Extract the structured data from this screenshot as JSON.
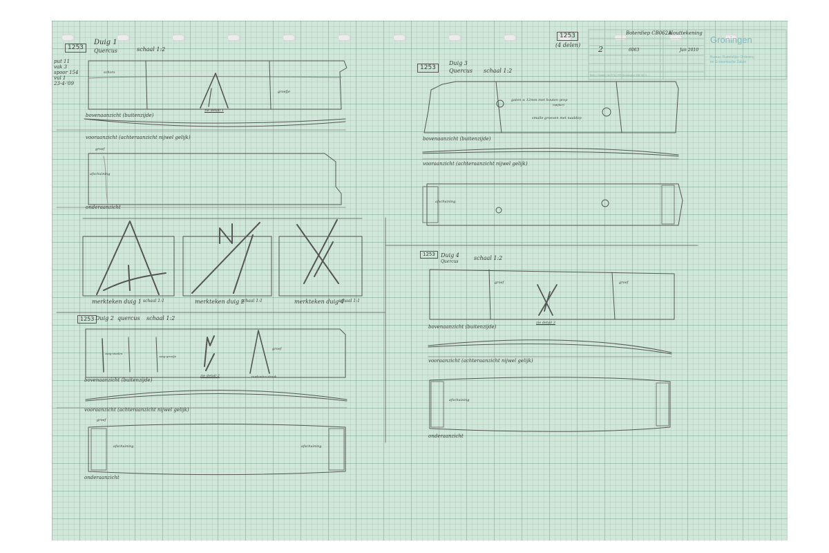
{
  "sheet": {
    "ref_number": "1253",
    "ref_count": "(4 delen)",
    "title_block": {
      "project": "Boterdiep CB062A",
      "subject": "Houttekening",
      "sheet_no": "2",
      "code": "6063",
      "date": "Jan 2010",
      "logo": "Groningen",
      "org_line1": "Bureau Ruimtelijke Ordening",
      "org_line2": "en Economische Zaken",
      "footer": "Brfo | Ondiep 4n 9711 FR   Groningen 050 3671 ..."
    }
  },
  "field_notes": [
    "put 11",
    "vak 3",
    "spoor 154",
    "vul 1",
    "23-4-'09"
  ],
  "duig1": {
    "box": "1253",
    "title": "Duig 1",
    "species": "Quercus",
    "scale": "schaal 1:2",
    "top_caption": "bovenaanzicht (buitenzijde)",
    "front_caption": "vooraanzicht (achteraanzicht nijwel gelijk)",
    "bottom_caption": "onderaanzicht",
    "labels": {
      "schors": "schors",
      "groefje": "groefje",
      "zie_detail": "zie detail 1",
      "groef": "groef",
      "afschuining": "afschuining"
    }
  },
  "marks": {
    "m1": "merkteken duig 1",
    "m1_scale": "schaal 1:1",
    "m2": "merkteken duig 2",
    "m2_scale": "schaal 1:1",
    "m3": "merkteken duig 4",
    "m3_scale": "schaal 1:1"
  },
  "duig2": {
    "box": "1253",
    "title": "Duig 2",
    "species": "quercus",
    "scale": "schaal 1:2",
    "top_caption": "bovenaanzicht (buitenzijde)",
    "front_caption": "vooraanzicht (achteraanzicht nijwel gelijk)",
    "bottom_caption": "onderaanzicht",
    "labels": {
      "zaagsnede": "zaag-sneden",
      "groefje": "zaag-groefje",
      "zie_detail": "zie detail 2",
      "groef": "groef",
      "ruw": "ruwhouten strook",
      "afschuining": "afschuining",
      "groef2": "groef"
    }
  },
  "duig3": {
    "box": "1253",
    "title": "Duig 3",
    "species": "Quercus",
    "scale": "schaal 1:2",
    "note1": "gaten ± 12mm met houten prop",
    "note1b": "(spijker)",
    "note2": "smalle groeven met naaldop",
    "top_caption": "bovenaanzicht (buitenzijde)",
    "front_caption": "vooraanzicht (achteraanzicht nijwel gelijk)",
    "afschuining": "afschuining"
  },
  "duig4": {
    "box": "1253",
    "title": "Duig 4",
    "species": "Quercus",
    "scale": "schaal 1:2",
    "top_caption": "bovenaanzicht (buitenzijde)",
    "front_caption": "vooraanzicht (achteraanzicht nijwel gelijk)",
    "bottom_caption": "onderaanzicht",
    "labels": {
      "groef": "groef",
      "groef2": "groef",
      "zie_detail": "zie detail 3",
      "afschuining": "afschuining"
    }
  }
}
